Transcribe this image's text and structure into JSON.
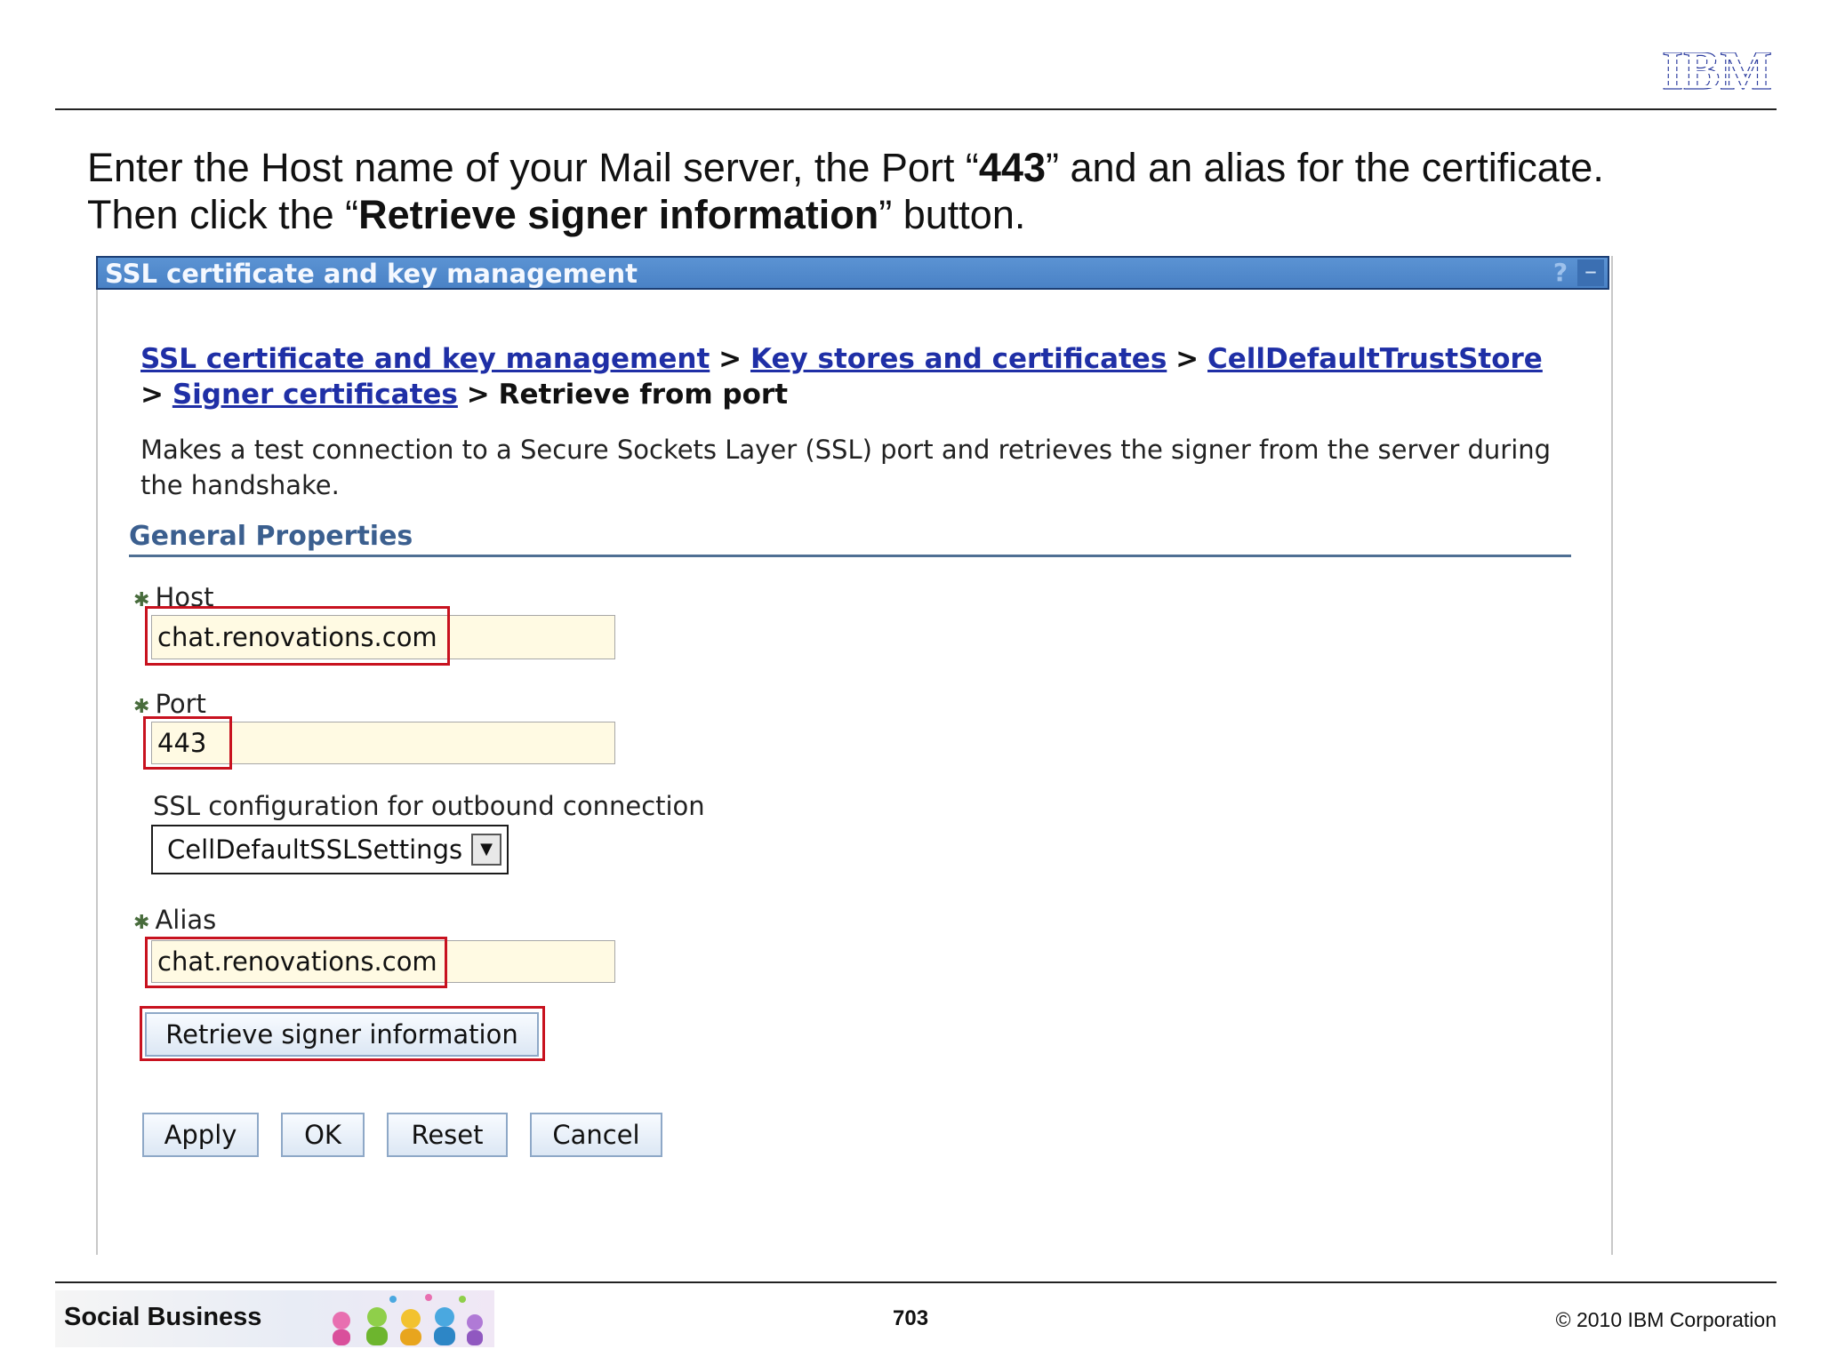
{
  "header": {
    "logo_text": "IBM"
  },
  "instructions": {
    "line1_pre": "Enter the Host name of your Mail server, the Port “",
    "line1_bold": "443",
    "line1_post": "” and an alias for the certificate.",
    "line2_pre": "Then click the “",
    "line2_bold": "Retrieve signer information",
    "line2_post": "” button."
  },
  "panel": {
    "title": "SSL certificate and key management",
    "help_label": "?",
    "minimize_label": "–"
  },
  "breadcrumb": {
    "items": [
      "SSL certificate and key management",
      "Key stores and certificates",
      "CellDefaultTrustStore",
      "Signer certificates"
    ],
    "separator": ">",
    "current": "Retrieve from port"
  },
  "description": "Makes a test connection to a Secure Sockets Layer (SSL) port and retrieves the signer from the server during the handshake.",
  "general_properties": {
    "title": "General Properties",
    "host": {
      "label": "Host",
      "value": "chat.renovations.com"
    },
    "port": {
      "label": "Port",
      "value": "443"
    },
    "ssl_config": {
      "label": "SSL configuration for outbound connection",
      "value": "CellDefaultSSLSettings"
    },
    "alias": {
      "label": "Alias",
      "value": "chat.renovations.com"
    },
    "retrieve_button": "Retrieve signer information"
  },
  "buttons": {
    "apply": "Apply",
    "ok": "OK",
    "reset": "Reset",
    "cancel": "Cancel"
  },
  "footer": {
    "brand": "Social Business",
    "page_number": "703",
    "copyright": "© 2010 IBM Corporation"
  },
  "colors": {
    "titlebar": "#4a82c6",
    "link": "#1f2fa6",
    "highlight": "#c8121f",
    "input_bg": "#fffae3",
    "logo": "#2f3fa0"
  }
}
